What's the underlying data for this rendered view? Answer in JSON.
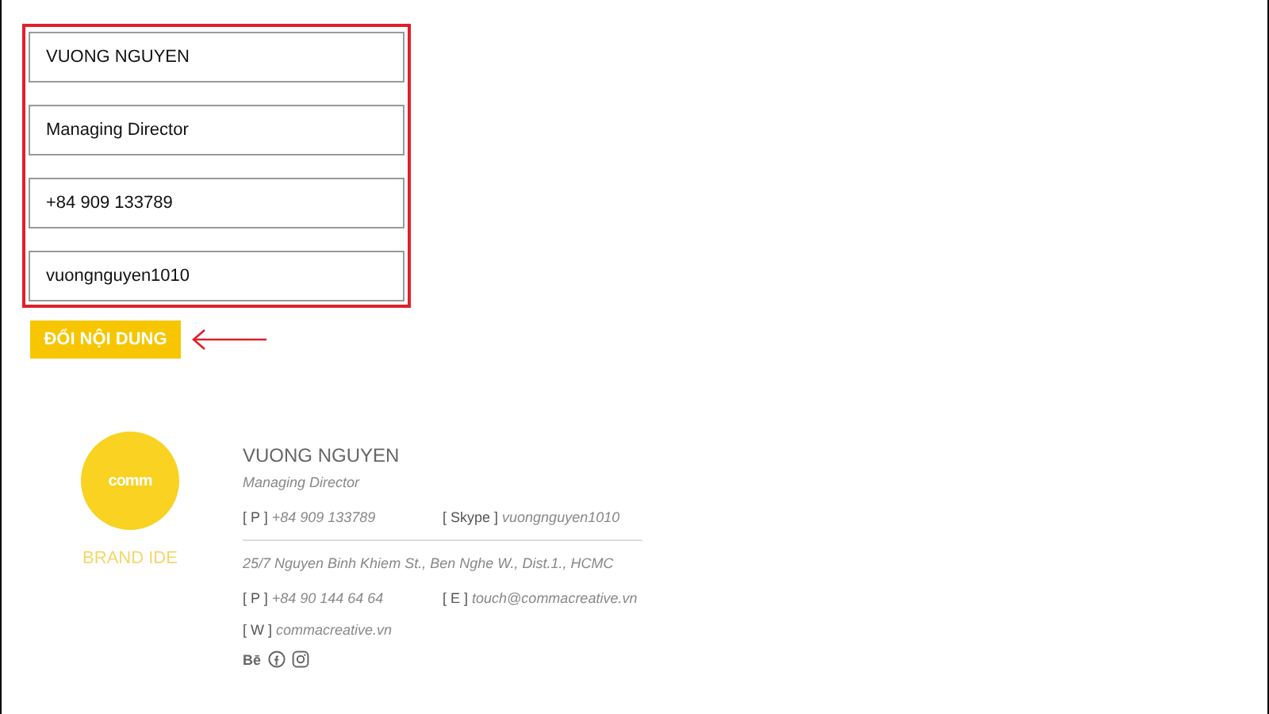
{
  "form": {
    "fields": [
      {
        "value": "VUONG NGUYEN"
      },
      {
        "value": "Managing Director"
      },
      {
        "value": "+84 909 133789"
      },
      {
        "value": "vuongnguyen1010"
      }
    ],
    "button": "ĐỔI NỘI DUNG"
  },
  "signature": {
    "logo_text": "comm",
    "logo_caption": "BRAND IDE",
    "name": "VUONG NGUYEN",
    "title": "Managing Director",
    "contacts": [
      {
        "label": "[ P ]",
        "value": "+84 909 133789"
      },
      {
        "label": "[ Skype ]",
        "value": "vuongnguyen1010"
      }
    ],
    "address": "25/7 Nguyen Binh Khiem St., Ben Nghe W., Dist.1., HCMC",
    "company_contacts": [
      {
        "label": "[ P ]",
        "value": "+84 90 144 64 64"
      },
      {
        "label": "[ E ]",
        "value": "touch@commacreative.vn"
      }
    ],
    "website": {
      "label": "[ W ]",
      "value": "commacreative.vn"
    },
    "social": "Bē"
  }
}
